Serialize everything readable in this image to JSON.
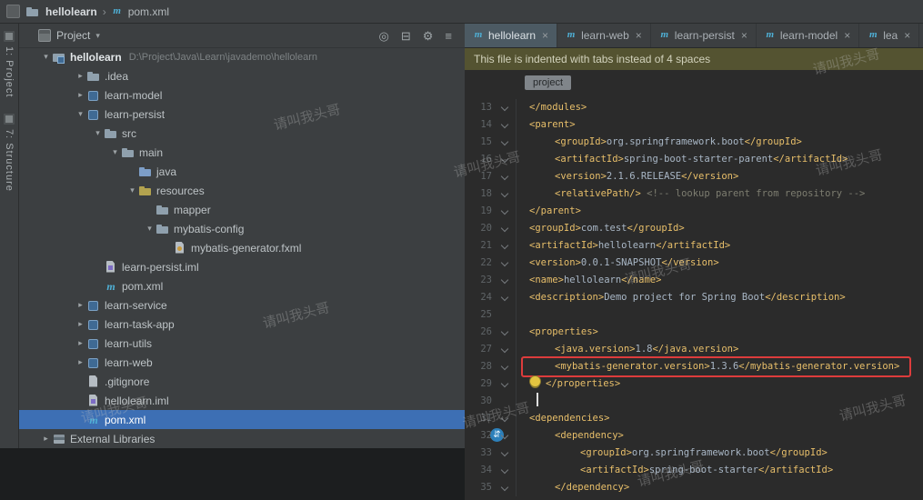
{
  "watermark": {
    "text": "请叫我头哥"
  },
  "topbar": {
    "project": "hellolearn",
    "separator": "›",
    "file": "pom.xml"
  },
  "stripe": {
    "project_label": "1: Project",
    "structure_label": "7: Structure"
  },
  "project_panel": {
    "title": "Project",
    "header_icons": [
      "locate",
      "collapse-all",
      "settings",
      "hide"
    ],
    "tree": [
      {
        "label": "hellolearn",
        "extra": "D:\\Project\\Java\\Learn\\javademo\\hellolearn",
        "level": 0,
        "arrow": "open",
        "icon": "module-root",
        "bold": true
      },
      {
        "label": ".idea",
        "level": 1,
        "arrow": "closed",
        "icon": "folder"
      },
      {
        "label": "learn-model",
        "level": 1,
        "arrow": "closed",
        "icon": "module"
      },
      {
        "label": "learn-persist",
        "level": 1,
        "arrow": "open",
        "icon": "module"
      },
      {
        "label": "src",
        "level": 2,
        "arrow": "open",
        "icon": "folder"
      },
      {
        "label": "main",
        "level": 3,
        "arrow": "open",
        "icon": "folder"
      },
      {
        "label": "java",
        "level": 4,
        "arrow": null,
        "icon": "folder-src"
      },
      {
        "label": "resources",
        "level": 4,
        "arrow": "open",
        "icon": "folder-res"
      },
      {
        "label": "mapper",
        "level": 5,
        "arrow": null,
        "icon": "folder"
      },
      {
        "label": "mybatis-config",
        "level": 5,
        "arrow": "open",
        "icon": "folder"
      },
      {
        "label": "mybatis-generator.fxml",
        "level": 6,
        "arrow": null,
        "icon": "file-code"
      },
      {
        "label": "learn-persist.iml",
        "level": 2,
        "arrow": null,
        "icon": "file-iml"
      },
      {
        "label": "pom.xml",
        "level": 2,
        "arrow": null,
        "icon": "maven"
      },
      {
        "label": "learn-service",
        "level": 1,
        "arrow": "closed",
        "icon": "module"
      },
      {
        "label": "learn-task-app",
        "level": 1,
        "arrow": "closed",
        "icon": "module"
      },
      {
        "label": "learn-utils",
        "level": 1,
        "arrow": "closed",
        "icon": "module"
      },
      {
        "label": "learn-web",
        "level": 1,
        "arrow": "closed",
        "icon": "module"
      },
      {
        "label": ".gitignore",
        "level": 1,
        "arrow": null,
        "icon": "file-plain"
      },
      {
        "label": "hellolearn.iml",
        "level": 1,
        "arrow": null,
        "icon": "file-iml"
      },
      {
        "label": "pom.xml",
        "level": 1,
        "arrow": null,
        "icon": "maven",
        "selected": true
      },
      {
        "label": "External Libraries",
        "level": 0,
        "arrow": "closed",
        "icon": "libraries"
      }
    ]
  },
  "editor": {
    "tabs": [
      {
        "label": "hellolearn",
        "selected": true
      },
      {
        "label": "learn-web"
      },
      {
        "label": "learn-persist"
      },
      {
        "label": "learn-model"
      },
      {
        "label": "lea"
      }
    ],
    "notification": "This file is indented with tabs instead of 4 spaces",
    "breadcrumb": "project",
    "colors": {
      "tag": "#e8bf6a",
      "text": "#a9b7c6",
      "comment": "#7d7d70",
      "selection": "#3d6fb4",
      "annotation": "#dd3c3c"
    },
    "code": [
      {
        "n": 13,
        "i": 1,
        "s": [
          [
            "t",
            "</modules>"
          ]
        ]
      },
      {
        "n": 14,
        "i": 1,
        "s": [
          [
            "t",
            "<parent>"
          ]
        ]
      },
      {
        "n": 15,
        "i": 2,
        "s": [
          [
            "t",
            "<groupId>"
          ],
          [
            "b",
            "org.springframework.boot"
          ],
          [
            "t",
            "</groupId>"
          ]
        ]
      },
      {
        "n": 16,
        "i": 2,
        "s": [
          [
            "t",
            "<artifactId>"
          ],
          [
            "b",
            "spring-boot-starter-parent"
          ],
          [
            "t",
            "</artifactId>"
          ]
        ]
      },
      {
        "n": 17,
        "i": 2,
        "s": [
          [
            "t",
            "<version>"
          ],
          [
            "b",
            "2.1.6.RELEASE"
          ],
          [
            "t",
            "</version>"
          ]
        ]
      },
      {
        "n": 18,
        "i": 2,
        "s": [
          [
            "t",
            "<relativePath/>"
          ],
          [
            "b",
            " "
          ],
          [
            "c",
            "<!-- lookup parent from repository -->"
          ]
        ]
      },
      {
        "n": 19,
        "i": 1,
        "s": [
          [
            "t",
            "</parent>"
          ]
        ]
      },
      {
        "n": 20,
        "i": 1,
        "s": [
          [
            "t",
            "<groupId>"
          ],
          [
            "b",
            "com.test"
          ],
          [
            "t",
            "</groupId>"
          ]
        ]
      },
      {
        "n": 21,
        "i": 1,
        "s": [
          [
            "t",
            "<artifactId>"
          ],
          [
            "b",
            "hellolearn"
          ],
          [
            "t",
            "</artifactId>"
          ]
        ]
      },
      {
        "n": 22,
        "i": 1,
        "s": [
          [
            "t",
            "<version>"
          ],
          [
            "b",
            "0.0.1-SNAPSHOT"
          ],
          [
            "t",
            "</version>"
          ]
        ]
      },
      {
        "n": 23,
        "i": 1,
        "s": [
          [
            "t",
            "<name>"
          ],
          [
            "b",
            "hellolearn"
          ],
          [
            "t",
            "</name>"
          ]
        ]
      },
      {
        "n": 24,
        "i": 1,
        "s": [
          [
            "t",
            "<description>"
          ],
          [
            "b",
            "Demo project for Spring Boot"
          ],
          [
            "t",
            "</description>"
          ]
        ]
      },
      {
        "n": 25,
        "i": 0,
        "s": []
      },
      {
        "n": 26,
        "i": 1,
        "s": [
          [
            "t",
            "<properties>"
          ]
        ]
      },
      {
        "n": 27,
        "i": 2,
        "s": [
          [
            "t",
            "<java.version>"
          ],
          [
            "b",
            "1.8"
          ],
          [
            "t",
            "</java.version>"
          ]
        ]
      },
      {
        "n": 28,
        "i": 2,
        "box": true,
        "s": [
          [
            "t",
            "<mybatis-generator.version>"
          ],
          [
            "b",
            "1.3.6"
          ],
          [
            "t",
            "</mybatis-generator.version>"
          ]
        ]
      },
      {
        "n": 29,
        "i": 1,
        "bulb": true,
        "s": [
          [
            "t",
            "</properties>"
          ]
        ]
      },
      {
        "n": 30,
        "i": 0,
        "caret": true,
        "s": []
      },
      {
        "n": 31,
        "i": 1,
        "s": [
          [
            "t",
            "<dependencies>"
          ]
        ]
      },
      {
        "n": 32,
        "i": 2,
        "s": [
          [
            "t",
            "<dependency>"
          ]
        ]
      },
      {
        "n": 33,
        "i": 3,
        "s": [
          [
            "t",
            "<groupId>"
          ],
          [
            "b",
            "org.springframework.boot"
          ],
          [
            "t",
            "</groupId>"
          ]
        ]
      },
      {
        "n": 34,
        "i": 3,
        "s": [
          [
            "t",
            "<artifactId>"
          ],
          [
            "b",
            "spring-boot-starter"
          ],
          [
            "t",
            "</artifactId>"
          ]
        ]
      },
      {
        "n": 35,
        "i": 2,
        "s": [
          [
            "t",
            "</dependency>"
          ]
        ]
      }
    ]
  }
}
